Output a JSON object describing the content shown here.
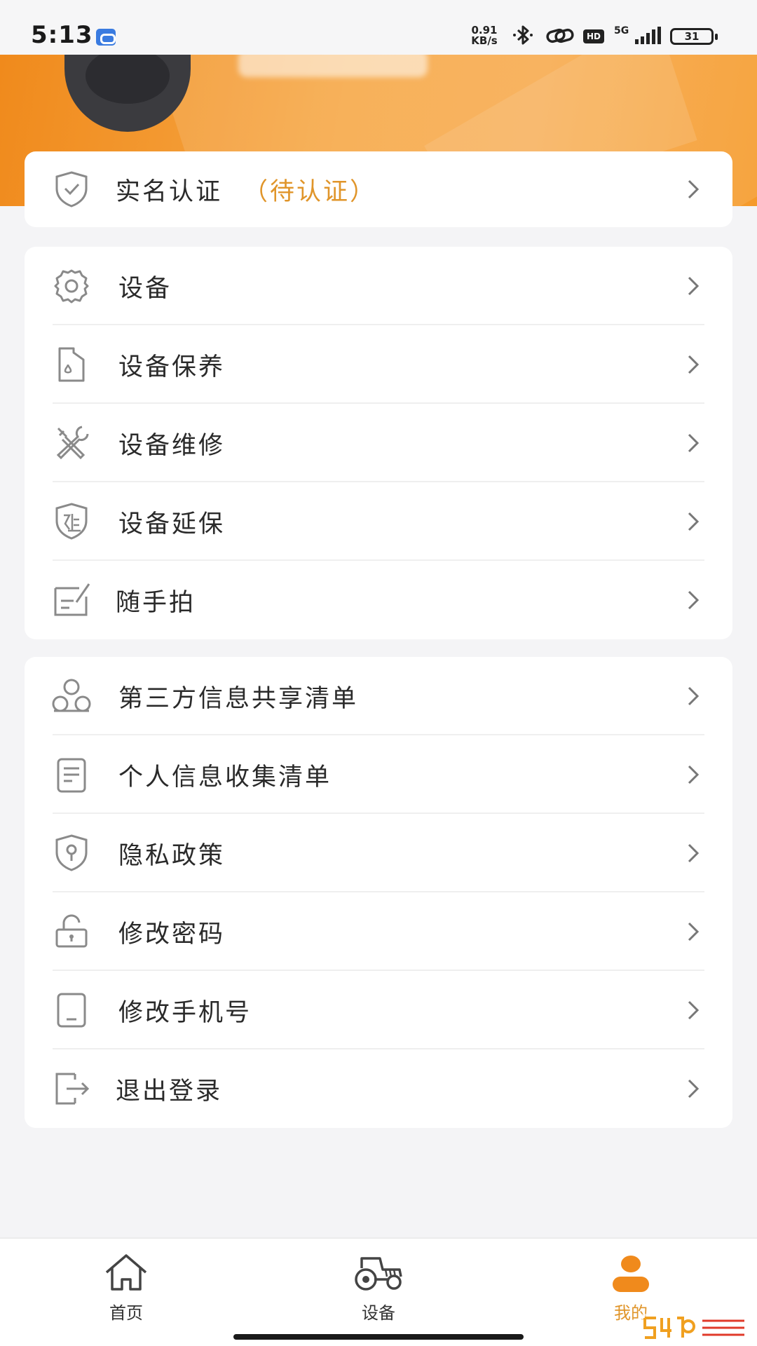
{
  "status_bar": {
    "time": "5:13",
    "net_speed_value": "0.91",
    "net_speed_unit": "KB/s",
    "hd": "HD",
    "network": "5G",
    "battery": "31",
    "icons": [
      "app-notification-icon",
      "bluetooth-icon",
      "link-icon",
      "hd-icon",
      "signal-icon",
      "battery-icon"
    ]
  },
  "header": {
    "avatar": "avatar-icon",
    "accent_color": "#f59a2a"
  },
  "verify": {
    "label": "实名认证",
    "status": "（待认证）",
    "icon": "shield-check-icon",
    "status_color": "#e0952a"
  },
  "group1": {
    "items": [
      {
        "label": "设备",
        "icon": "gear-icon"
      },
      {
        "label": "设备保养",
        "icon": "oil-can-icon"
      },
      {
        "label": "设备维修",
        "icon": "tools-icon"
      },
      {
        "label": "设备延保",
        "icon": "extended-warranty-icon"
      },
      {
        "label": "随手拍",
        "icon": "note-edit-icon"
      }
    ]
  },
  "group2": {
    "items": [
      {
        "label": "第三方信息共享清单",
        "icon": "share-nodes-icon"
      },
      {
        "label": "个人信息收集清单",
        "icon": "document-list-icon"
      },
      {
        "label": "隐私政策",
        "icon": "privacy-shield-icon"
      },
      {
        "label": "修改密码",
        "icon": "lock-icon"
      },
      {
        "label": "修改手机号",
        "icon": "phone-icon"
      },
      {
        "label": "退出登录",
        "icon": "logout-icon"
      }
    ]
  },
  "bottom_nav": {
    "items": [
      {
        "label": "首页",
        "icon": "home-icon"
      },
      {
        "label": "设备",
        "icon": "tractor-icon"
      },
      {
        "label": "我的",
        "icon": "user-icon",
        "active": true
      }
    ],
    "active_color": "#e0952a"
  }
}
